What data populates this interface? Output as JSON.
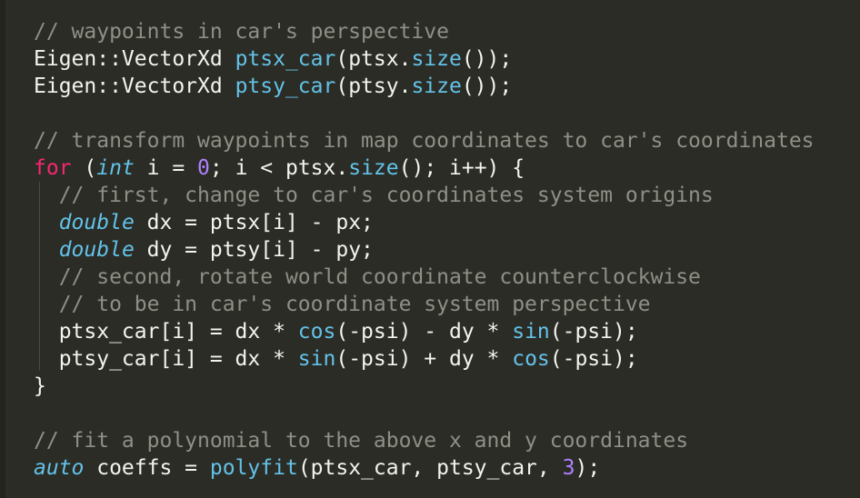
{
  "editor": {
    "colors": {
      "background": "#2b2c26",
      "text": "#f4f4ee",
      "comment": "#8f8f86",
      "keyword": "#f92672",
      "type": "#63c2e8",
      "function": "#63c2e8",
      "number": "#ae81ff"
    },
    "lines": [
      [
        {
          "t": "// waypoints in car's perspective",
          "c": "cmt"
        }
      ],
      [
        {
          "t": "Eigen::VectorXd ",
          "c": "txt"
        },
        {
          "t": "ptsx_car",
          "c": "fn"
        },
        {
          "t": "(ptsx.",
          "c": "txt"
        },
        {
          "t": "size",
          "c": "fn"
        },
        {
          "t": "());",
          "c": "txt"
        }
      ],
      [
        {
          "t": "Eigen::VectorXd ",
          "c": "txt"
        },
        {
          "t": "ptsy_car",
          "c": "fn"
        },
        {
          "t": "(ptsy.",
          "c": "txt"
        },
        {
          "t": "size",
          "c": "fn"
        },
        {
          "t": "());",
          "c": "txt"
        }
      ],
      [],
      [
        {
          "t": "// transform waypoints in map coordinates to car's coordinates",
          "c": "cmt"
        }
      ],
      [
        {
          "t": "for",
          "c": "kw"
        },
        {
          "t": " (",
          "c": "txt"
        },
        {
          "t": "int",
          "c": "typ"
        },
        {
          "t": " i = ",
          "c": "txt"
        },
        {
          "t": "0",
          "c": "num"
        },
        {
          "t": "; i < ptsx.",
          "c": "txt"
        },
        {
          "t": "size",
          "c": "fn"
        },
        {
          "t": "(); i++) {",
          "c": "txt"
        }
      ],
      [
        {
          "t": "  // first, change to car's coordinates system origins",
          "c": "cmt"
        }
      ],
      [
        {
          "t": "  ",
          "c": "txt"
        },
        {
          "t": "double",
          "c": "typ"
        },
        {
          "t": " dx = ptsx[i] - px;",
          "c": "txt"
        }
      ],
      [
        {
          "t": "  ",
          "c": "txt"
        },
        {
          "t": "double",
          "c": "typ"
        },
        {
          "t": " dy = ptsy[i] - py;",
          "c": "txt"
        }
      ],
      [
        {
          "t": "  // second, rotate world coordinate counterclockwise",
          "c": "cmt"
        }
      ],
      [
        {
          "t": "  // to be in car's coordinate system perspective",
          "c": "cmt"
        }
      ],
      [
        {
          "t": "  ptsx_car[i] = dx * ",
          "c": "txt"
        },
        {
          "t": "cos",
          "c": "fn"
        },
        {
          "t": "(-psi) - dy * ",
          "c": "txt"
        },
        {
          "t": "sin",
          "c": "fn"
        },
        {
          "t": "(-psi);",
          "c": "txt"
        }
      ],
      [
        {
          "t": "  ptsy_car[i] = dx * ",
          "c": "txt"
        },
        {
          "t": "sin",
          "c": "fn"
        },
        {
          "t": "(-psi) + dy * ",
          "c": "txt"
        },
        {
          "t": "cos",
          "c": "fn"
        },
        {
          "t": "(-psi);",
          "c": "txt"
        }
      ],
      [
        {
          "t": "}",
          "c": "txt"
        }
      ],
      [],
      [
        {
          "t": "// fit a polynomial to the above x and y coordinates",
          "c": "cmt"
        }
      ],
      [
        {
          "t": "auto",
          "c": "typ"
        },
        {
          "t": " coeffs = ",
          "c": "txt"
        },
        {
          "t": "polyfit",
          "c": "fn"
        },
        {
          "t": "(ptsx_car, ptsy_car, ",
          "c": "txt"
        },
        {
          "t": "3",
          "c": "num"
        },
        {
          "t": ");",
          "c": "txt"
        }
      ]
    ]
  }
}
